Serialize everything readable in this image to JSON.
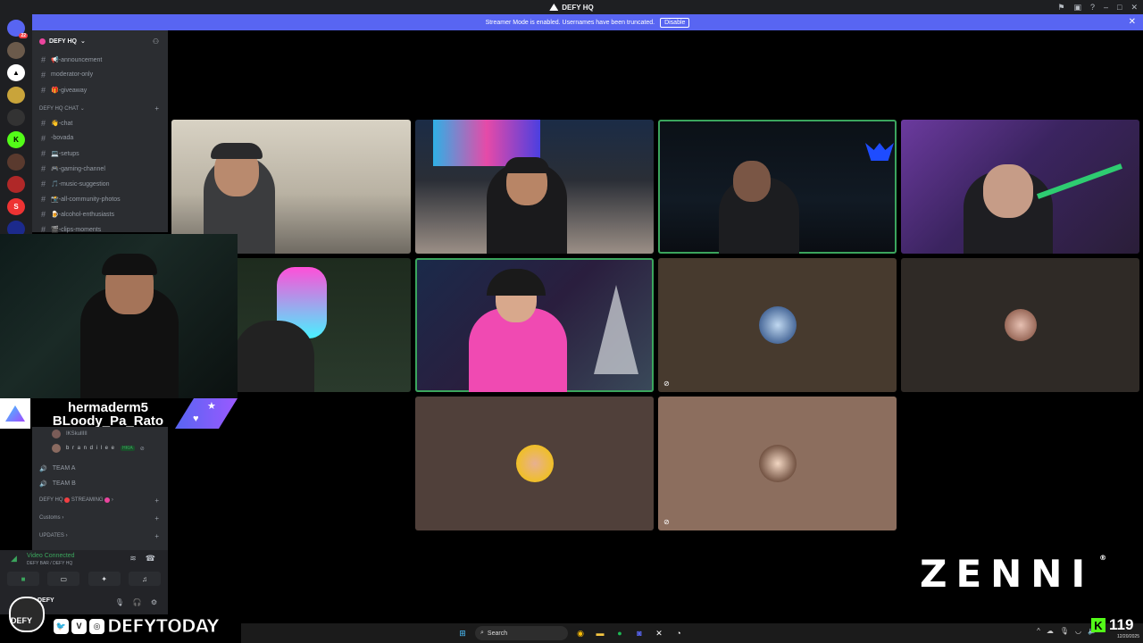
{
  "window": {
    "title": "DEFY HQ"
  },
  "banner": {
    "message": "Streamer Mode is enabled. Usernames have been truncated.",
    "disable_label": "Disable"
  },
  "server_rail": {
    "top_badge": "22",
    "servers": [
      "",
      "",
      "",
      "",
      "",
      "",
      "",
      "",
      "",
      "",
      ""
    ]
  },
  "sidebar": {
    "server_name": "DEFY HQ",
    "channels_top": [
      {
        "label": "📢-announcement"
      },
      {
        "label": "moderator-only"
      },
      {
        "label": "🎁-giveaway"
      }
    ],
    "category_chat": "DEFY HQ CHAT",
    "channels_chat": [
      {
        "label": "👋-chat"
      },
      {
        "label": "-bovada"
      },
      {
        "label": "💻-setups"
      },
      {
        "label": "🎮-gaming-channel"
      },
      {
        "label": "🎵-music-suggestion"
      },
      {
        "label": "📸-all-community-photos"
      },
      {
        "label": "🍺-alcohol-enthusiasts"
      },
      {
        "label": "🎬-clips-moments"
      }
    ]
  },
  "lower_sidebar": {
    "voice_users": [
      {
        "name": "IKSkullIII",
        "tag": ""
      },
      {
        "name": "b r a n d i l e e",
        "tag": "HKIA"
      }
    ],
    "voice_channels": [
      {
        "label": "TEAM A"
      },
      {
        "label": "TEAM B"
      }
    ],
    "categories": [
      {
        "label": "DEFY HQ",
        "suffix": "STREAMING"
      },
      {
        "label": "Customs"
      },
      {
        "label": "UPDATES"
      }
    ]
  },
  "voice_panel": {
    "status": "Video Connected",
    "location": "DEFY BAR / DEFY HQ"
  },
  "user_panel": {
    "username": "DEFY"
  },
  "overlay": {
    "name_line_1": "hermaderm5",
    "name_line_2": "BLoody_Pa_Rato",
    "social_handle": "DEFYTODAY",
    "mascot_text": "DEFY",
    "sponsor": "ZENNI",
    "sponsor_mark": "®"
  },
  "taskbar": {
    "search_placeholder": "Search",
    "date": "12/20/2025"
  },
  "kick": {
    "viewer_count": "119"
  },
  "colors": {
    "accent": "#5865f2",
    "speaking": "#3ba55d",
    "kick_green": "#53fc18"
  }
}
